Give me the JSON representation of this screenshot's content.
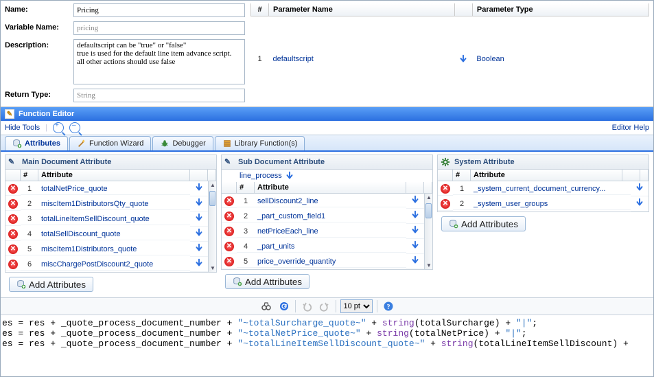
{
  "form": {
    "name_label": "Name:",
    "name_value": "Pricing",
    "variable_label": "Variable Name:",
    "variable_value": "pricing",
    "description_label": "Description:",
    "description_value": "defaultscript can be \"true\" or \"false\"\ntrue is used for the default line item advance script.  all other actions should use false",
    "return_label": "Return Type:",
    "return_value": "String"
  },
  "param_table": {
    "col_num": "#",
    "col_name": "Parameter Name",
    "col_type": "Parameter Type",
    "rows": [
      {
        "num": "1",
        "name": "defaultscript",
        "type": "Boolean"
      }
    ]
  },
  "editor_bar": {
    "title": "Function Editor"
  },
  "toolbar": {
    "hide_tools": "Hide Tools",
    "editor_help": "Editor Help"
  },
  "subtabs": {
    "attributes": "Attributes",
    "wizard": "Function Wizard",
    "debugger": "Debugger",
    "library": "Library Function(s)"
  },
  "panels": {
    "main": {
      "title": "Main Document Attribute",
      "col_num": "#",
      "col_attr": "Attribute",
      "rows": [
        {
          "n": "1",
          "name": "totalNetPrice_quote"
        },
        {
          "n": "2",
          "name": "miscItem1DistributorsQty_quote"
        },
        {
          "n": "3",
          "name": "totalLineItemSellDiscount_quote"
        },
        {
          "n": "4",
          "name": "totalSellDiscount_quote"
        },
        {
          "n": "5",
          "name": "miscItem1Distributors_quote"
        },
        {
          "n": "6",
          "name": "miscChargePostDiscount2_quote"
        }
      ],
      "add_btn": "Add Attributes"
    },
    "sub": {
      "title": "Sub Document Attribute",
      "subhead": "line_process",
      "col_num": "#",
      "col_attr": "Attribute",
      "rows": [
        {
          "n": "1",
          "name": "sellDiscount2_line"
        },
        {
          "n": "2",
          "name": "_part_custom_field1"
        },
        {
          "n": "3",
          "name": "netPriceEach_line"
        },
        {
          "n": "4",
          "name": "_part_units"
        },
        {
          "n": "5",
          "name": "price_override_quantity"
        }
      ],
      "add_btn": "Add Attributes"
    },
    "sys": {
      "title": "System Attribute",
      "col_num": "#",
      "col_attr": "Attribute",
      "rows": [
        {
          "n": "1",
          "name": "_system_current_document_currency..."
        },
        {
          "n": "2",
          "name": "_system_user_groups"
        }
      ],
      "add_btn": "Add Attributes"
    }
  },
  "code_toolbar": {
    "font_size": "10 pt"
  },
  "code": {
    "l1a": "es = res + _quote_process_document_number + ",
    "l1b": "\"~totalSurcharge_quote~\"",
    "l1c": " + ",
    "l1d": "string",
    "l1e": "(totalSurcharge) + ",
    "l1f": "\"|\"",
    "l1g": ";",
    "l2a": "es = res + _quote_process_document_number + ",
    "l2b": "\"~totalNetPrice_quote~\"",
    "l2c": " + ",
    "l2d": "string",
    "l2e": "(totalNetPrice) + ",
    "l2f": "\"|\"",
    "l2g": ";",
    "l3a": "es = res + _quote_process_document_number + ",
    "l3b": "\"~totalLineItemSellDiscount_quote~\"",
    "l3c": " + ",
    "l3d": "string",
    "l3e": "(totalLineItemSellDiscount) +"
  }
}
